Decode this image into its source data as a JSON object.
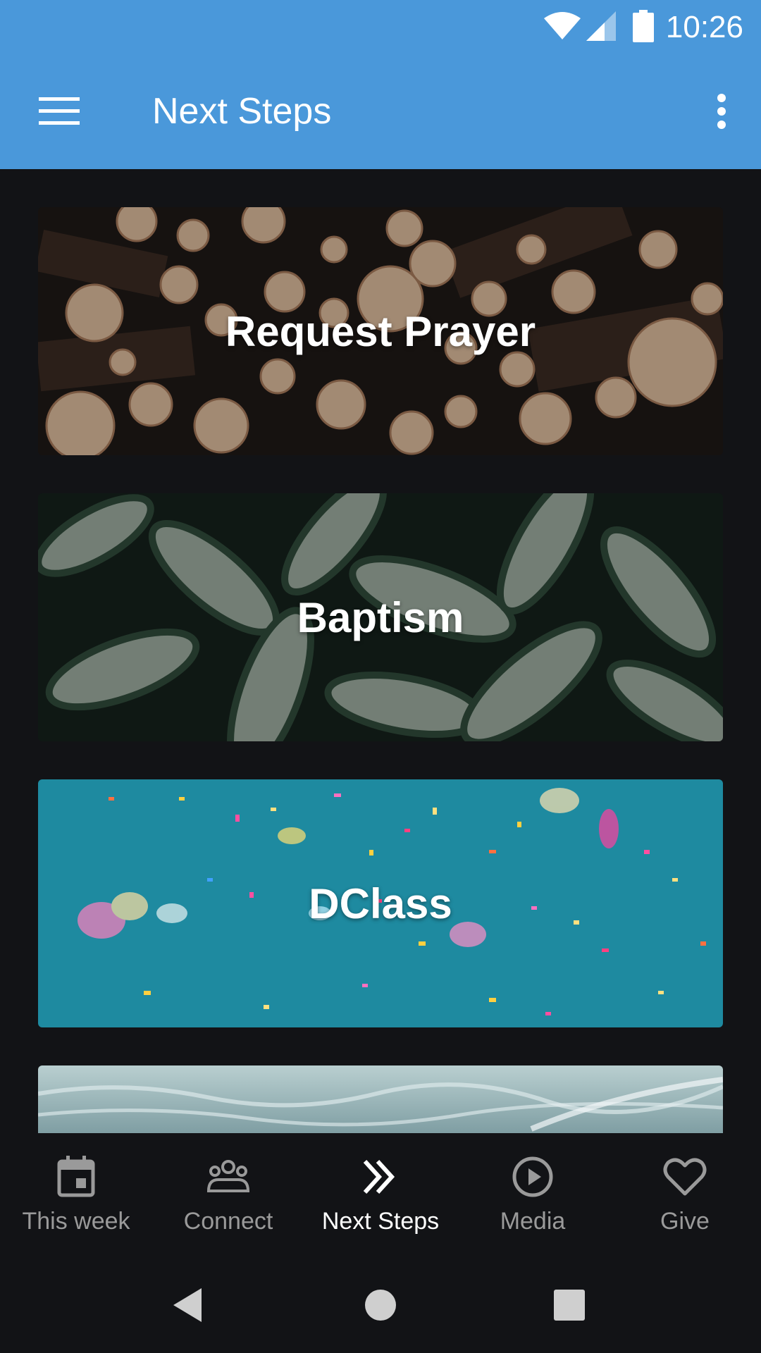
{
  "status_bar": {
    "time": "10:26",
    "icons": [
      "wifi-icon",
      "cell-signal-icon",
      "battery-icon"
    ]
  },
  "toolbar": {
    "title": "Next Steps",
    "menu_icon": "hamburger-menu-icon",
    "overflow_icon": "more-vert-icon",
    "background_color": "#4a98da"
  },
  "cards": [
    {
      "label": "Request Prayer",
      "image": "stacked-logs"
    },
    {
      "label": "Baptism",
      "image": "variegated-leaves"
    },
    {
      "label": "DClass",
      "image": "confetti-on-teal"
    },
    {
      "label": "",
      "image": "water-waves"
    }
  ],
  "bottom_nav": {
    "items": [
      {
        "label": "This week",
        "icon": "calendar-icon",
        "active": false
      },
      {
        "label": "Connect",
        "icon": "people-icon",
        "active": false
      },
      {
        "label": "Next Steps",
        "icon": "double-chevron-icon",
        "active": true
      },
      {
        "label": "Media",
        "icon": "play-circle-icon",
        "active": false
      },
      {
        "label": "Give",
        "icon": "heart-icon",
        "active": false
      }
    ]
  },
  "system_nav": {
    "icons": [
      "back-icon",
      "home-icon",
      "recents-icon"
    ]
  }
}
